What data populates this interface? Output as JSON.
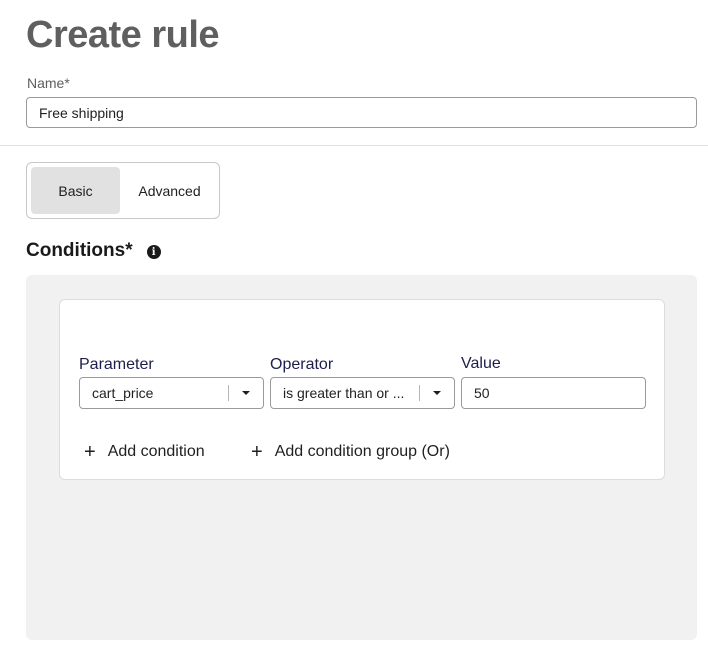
{
  "page": {
    "title": "Create rule"
  },
  "name_field": {
    "label": "Name*",
    "value": "Free shipping"
  },
  "mode_toggle": {
    "basic_label": "Basic",
    "advanced_label": "Advanced",
    "selected": "Basic"
  },
  "conditions": {
    "title": "Conditions*",
    "info_icon": "info-icon",
    "group": {
      "parameter": {
        "label": "Parameter",
        "value": "cart_price"
      },
      "operator": {
        "label": "Operator",
        "value": "is greater than or ..."
      },
      "value": {
        "label": "Value",
        "value": "50"
      },
      "add_condition_label": "Add condition",
      "add_group_label": "Add condition group (Or)"
    }
  },
  "colors": {
    "title": "#5f5f5f",
    "selected_toggle": "#e1e1e1",
    "conditions_bg": "#f1f1f1",
    "field_label": "#1c1f4a"
  }
}
